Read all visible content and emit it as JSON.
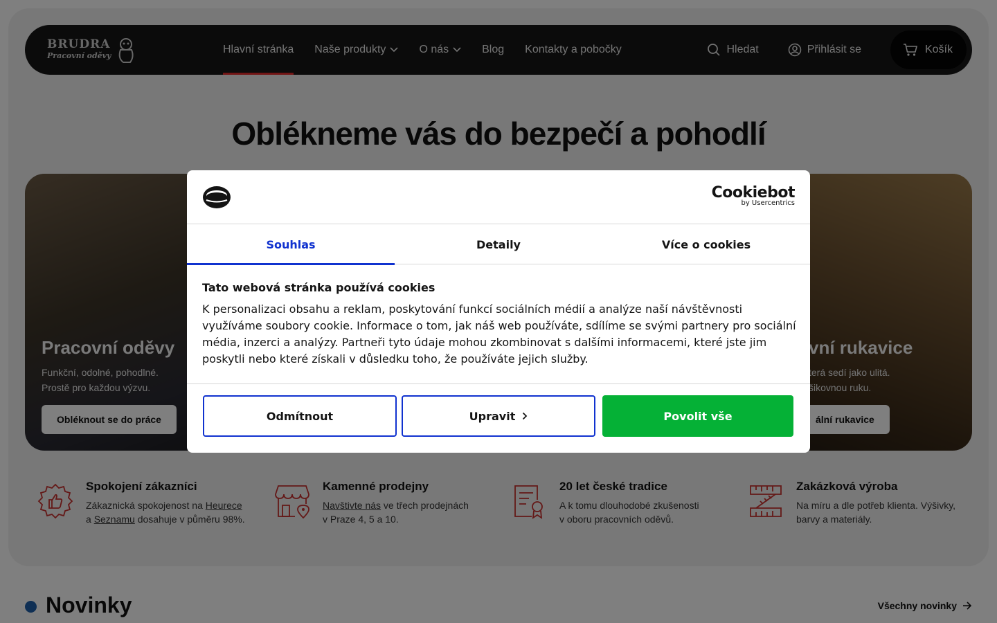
{
  "colors": {
    "accent_red": "#e52b2b",
    "tab_blue": "#1032cf",
    "allow_green": "#05b136",
    "news_dot": "#1f5fa8"
  },
  "header": {
    "logo_line1": "BRUDRA",
    "logo_line2": "Pracovní oděvy",
    "nav": [
      {
        "label": "Hlavní stránka",
        "active": true
      },
      {
        "label": "Naše produkty",
        "dropdown": true
      },
      {
        "label": "O nás",
        "dropdown": true
      },
      {
        "label": "Blog"
      },
      {
        "label": "Kontakty a pobočky"
      }
    ],
    "search_label": "Hledat",
    "login_label": "Přihlásit se",
    "cart_label": "Košík"
  },
  "hero": {
    "headline": "Oblékneme vás do bezpečí a pohodlí",
    "left": {
      "title": "Pracovní oděvy",
      "line1": "Funkční, odolné, pohodlné.",
      "line2": "Prostě pro každou výzvu.",
      "button": "Obléknout se do práce"
    },
    "right": {
      "title": "vní rukavice",
      "line1": "terá sedí jako ulitá.",
      "line2": "šikovnou ruku.",
      "button": "ální rukavice"
    }
  },
  "features": [
    {
      "icon": "thumbs-up-icon",
      "title": "Spokojení zákazníci",
      "t1": "Zákaznická spokojenost na ",
      "l1": "Heurece",
      "t2": "a ",
      "l2": "Seznamu",
      "t3": " dosahuje v půměru 98%."
    },
    {
      "icon": "store-icon",
      "title": "Kamenné prodejny",
      "l1": "Navštivte nás",
      "t1": " ve třech prodejnách",
      "t2": "v Praze 4, 5 a 10."
    },
    {
      "icon": "certificate-icon",
      "title": "20 let české tradice",
      "t1": "A k tomu dlouhodobé zkušenosti",
      "t2": "v oboru pracovních oděvů."
    },
    {
      "icon": "ruler-icon",
      "title": "Zakázková výroba",
      "t1": "Na míru a dle potřeb klienta. Výšivky,",
      "t2": "barvy a materiály."
    }
  ],
  "news": {
    "title": "Novinky",
    "link": "Všechny novinky"
  },
  "cookie_dialog": {
    "brand": "Cookiebot",
    "brand_sub": "by Usercentrics",
    "tabs": [
      {
        "label": "Souhlas",
        "active": true
      },
      {
        "label": "Detaily"
      },
      {
        "label": "Více o cookies"
      }
    ],
    "title": "Tato webová stránka používá cookies",
    "text": "K personalizaci obsahu a reklam, poskytování funkcí sociálních médií a analýze naší návštěvnosti využíváme soubory cookie. Informace o tom, jak náš web používáte, sdílíme se svými partnery pro sociální média, inzerci a analýzy. Partneři tyto údaje mohou zkombinovat s dalšími informacemi, které jste jim poskytli nebo které získali v důsledku toho, že používáte jejich služby.",
    "btn_reject": "Odmítnout",
    "btn_customize": "Upravit",
    "btn_allow": "Povolit vše"
  }
}
